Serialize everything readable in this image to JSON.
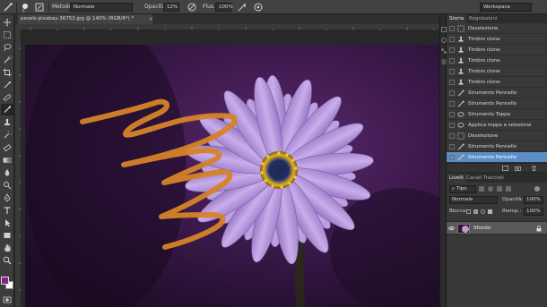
{
  "options_bar": {
    "mode_label": "Metodo:",
    "mode_value": "Normale",
    "opacity_label": "Opacità:",
    "opacity_value": "12%",
    "flow_label": "Flus.:",
    "flow_value": "100%",
    "workspace_value": "Workspace"
  },
  "document": {
    "tab_label": "pexels-pixabay-36753.jpg @ 140% (RGB/8*) *",
    "close_glyph": "×"
  },
  "colors": {
    "accent_select": "#5b8ec4",
    "foreground_swatch": "#8e1d86",
    "background_swatch": "#ffffff",
    "brush_stroke": "#d68328",
    "petal": "#b897de",
    "flower_center": "#e2b020"
  },
  "history": {
    "tab_active": "Storia",
    "tab_other": "Regolazioni",
    "items": [
      {
        "label": "Deselezione",
        "icon": "selection-icon"
      },
      {
        "label": "Timbro clone",
        "icon": "clone-stamp-icon"
      },
      {
        "label": "Timbro clone",
        "icon": "clone-stamp-icon"
      },
      {
        "label": "Timbro clone",
        "icon": "clone-stamp-icon"
      },
      {
        "label": "Timbro clone",
        "icon": "clone-stamp-icon"
      },
      {
        "label": "Timbro clone",
        "icon": "clone-stamp-icon"
      },
      {
        "label": "Strumento Pennello",
        "icon": "brush-icon"
      },
      {
        "label": "Strumento Pennello",
        "icon": "brush-icon"
      },
      {
        "label": "Strumento Toppa",
        "icon": "patch-icon"
      },
      {
        "label": "Applica toppa a selezione",
        "icon": "patch-icon"
      },
      {
        "label": "Deselezione",
        "icon": "selection-icon"
      },
      {
        "label": "Strumento Pennello",
        "icon": "brush-icon"
      },
      {
        "label": "Strumento Pennello",
        "icon": "brush-icon",
        "selected": true
      }
    ]
  },
  "layers": {
    "tab_active": "Livelli",
    "tab_channels": "Canali",
    "tab_paths": "Tracciati",
    "filter_label": "Tipo",
    "blend_value": "Normale",
    "opacity_label": "Opacità:",
    "opacity_value": "100%",
    "lock_label": "Blocca:",
    "fill_label": "Riemp.:",
    "fill_value": "100%",
    "layer_name": "Sfondo"
  }
}
